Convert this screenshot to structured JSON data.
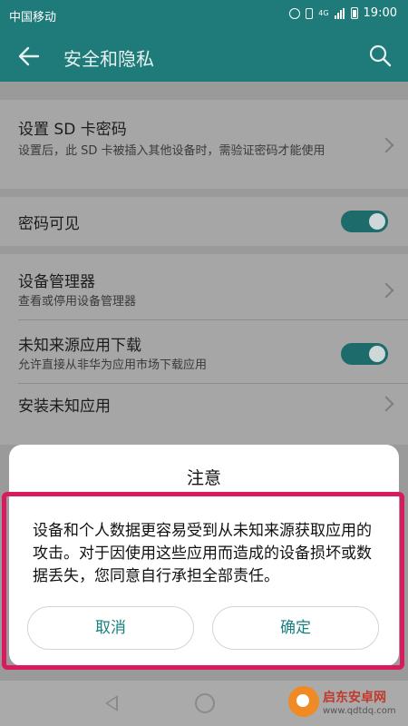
{
  "status_bar": {
    "carrier": "中国移动",
    "time": "19:00",
    "network": "4G"
  },
  "app_bar": {
    "title": "安全和隐私"
  },
  "settings": {
    "sd_card": {
      "title": "设置 SD 卡密码",
      "subtitle": "设置后，此 SD 卡被插入其他设备时，需验证密码才能使用"
    },
    "password_visible": {
      "title": "密码可见",
      "enabled": true
    },
    "device_admin": {
      "title": "设备管理器",
      "subtitle": "查看或停用设备管理器"
    },
    "unknown_sources": {
      "title": "未知来源应用下载",
      "subtitle": "允许直接从非华为应用市场下载应用",
      "enabled": true
    },
    "install_unknown": {
      "title": "安装未知应用"
    }
  },
  "dialog": {
    "title": "注意",
    "message": "设备和个人数据更容易受到从未知来源获取应用的攻击。对于因使用这些应用而造成的设备损坏或数据丢失，您同意自行承担全部责任。",
    "cancel_label": "取消",
    "confirm_label": "确定"
  },
  "watermark": {
    "name": "启东安卓网",
    "url": "www.qdtdq.com"
  },
  "colors": {
    "accent": "#1f7a7a",
    "highlight": "#d81b60"
  }
}
